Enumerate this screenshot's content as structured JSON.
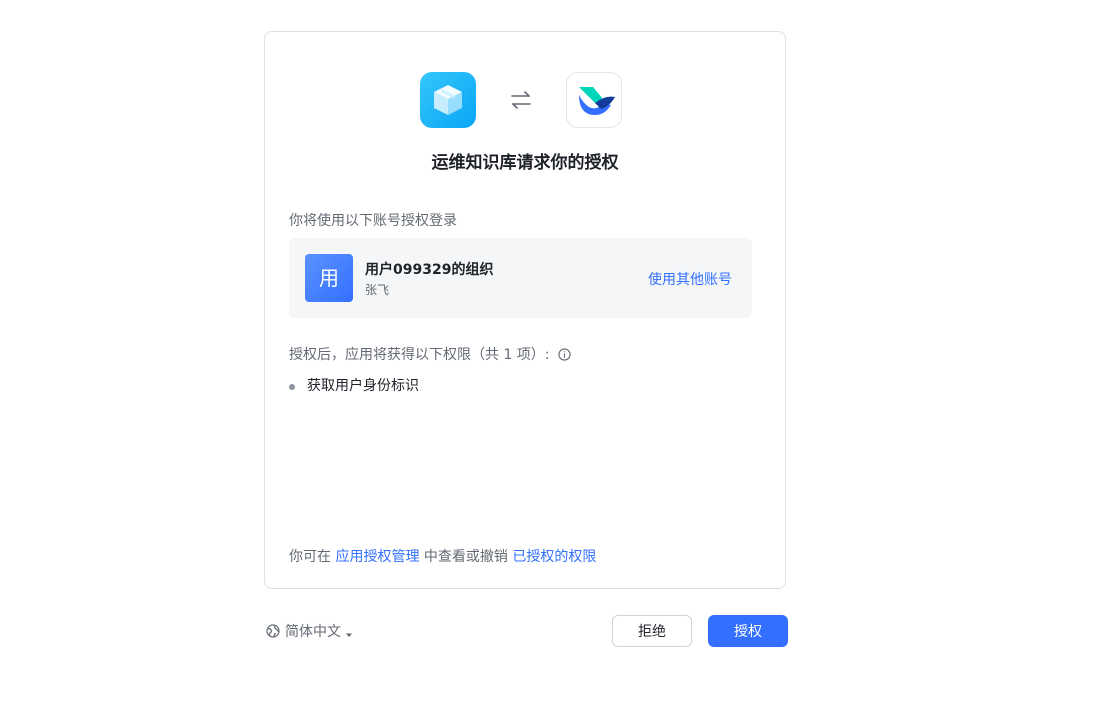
{
  "header": {
    "app_logo_icon": "cube-icon",
    "swap_icon": "swap-arrows-icon",
    "platform_logo_icon": "lark-bird-icon",
    "title": "运维知识库请求你的授权"
  },
  "account": {
    "section_label": "你将使用以下账号授权登录",
    "avatar_text": "用",
    "org_name": "用户099329的组织",
    "user_name": "张飞",
    "switch_label": "使用其他账号"
  },
  "permissions": {
    "section_label": "授权后，应用将获得以下权限（共 1 项）:",
    "items": [
      "获取用户身份标识"
    ]
  },
  "footer": {
    "prefix": "你可在",
    "manage_link": "应用授权管理",
    "middle": "中查看或撤销",
    "authorized_link": "已授权的权限"
  },
  "language": {
    "selected": "简体中文"
  },
  "actions": {
    "reject_label": "拒绝",
    "authorize_label": "授权"
  },
  "colors": {
    "accent": "#3370ff",
    "app_logo": "#1fb6fa"
  }
}
